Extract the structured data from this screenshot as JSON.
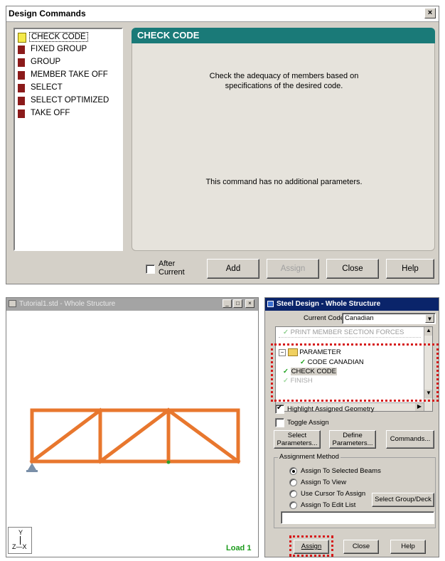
{
  "design_commands": {
    "title": "Design Commands",
    "close_glyph": "×",
    "commands": [
      {
        "label": "CHECK CODE",
        "selected": true
      },
      {
        "label": "FIXED GROUP",
        "selected": false
      },
      {
        "label": "GROUP",
        "selected": false
      },
      {
        "label": "MEMBER TAKE OFF",
        "selected": false
      },
      {
        "label": "SELECT",
        "selected": false
      },
      {
        "label": "SELECT OPTIMIZED",
        "selected": false
      },
      {
        "label": "TAKE OFF",
        "selected": false
      }
    ],
    "panel_title": "CHECK CODE",
    "description_line1": "Check the adequacy of members based on",
    "description_line2": "specifications of the desired code.",
    "no_params_text": "This command has no additional parameters.",
    "after_current_line1": "After",
    "after_current_line2": "Current",
    "buttons": {
      "add": "Add",
      "assign": "Assign",
      "close": "Close",
      "help": "Help"
    }
  },
  "structure_window": {
    "title": "Tutorial1.std - Whole Structure",
    "load_label": "Load 1",
    "axis_y": "Y",
    "axis_zx": "Z—X",
    "member_color": "#e8772e",
    "support_color": "#7a8fa8",
    "node_color": "#2aa02a"
  },
  "steel_design": {
    "title": "Steel Design - Whole Structure",
    "current_code_label": "Current Code:",
    "current_code_value": "Canadian",
    "tree_items": {
      "print_member": "PRINT MEMBER SECTION FORCES",
      "parameter": "PARAMETER",
      "code_canadian": "CODE CANADIAN",
      "check_code": "CHECK CODE",
      "finish": "FINISH"
    },
    "highlight_label": "Highlight Assigned Geometry",
    "toggle_label": "Toggle Assign",
    "select_params_1": "Select",
    "select_params_2": "Parameters...",
    "define_params_1": "Define",
    "define_params_2": "Parameters...",
    "commands_btn": "Commands...",
    "assignment_method": "Assignment Method",
    "radios": [
      {
        "label": "Assign To Selected Beams",
        "selected": true
      },
      {
        "label": "Assign To View",
        "selected": false
      },
      {
        "label": "Use Cursor To Assign",
        "selected": false
      },
      {
        "label": "Assign To Edit List",
        "selected": false
      }
    ],
    "select_group_btn": "Select Group/Deck",
    "buttons": {
      "assign": "Assign",
      "close": "Close",
      "help": "Help"
    },
    "highlight_color": "#d61a1a"
  }
}
